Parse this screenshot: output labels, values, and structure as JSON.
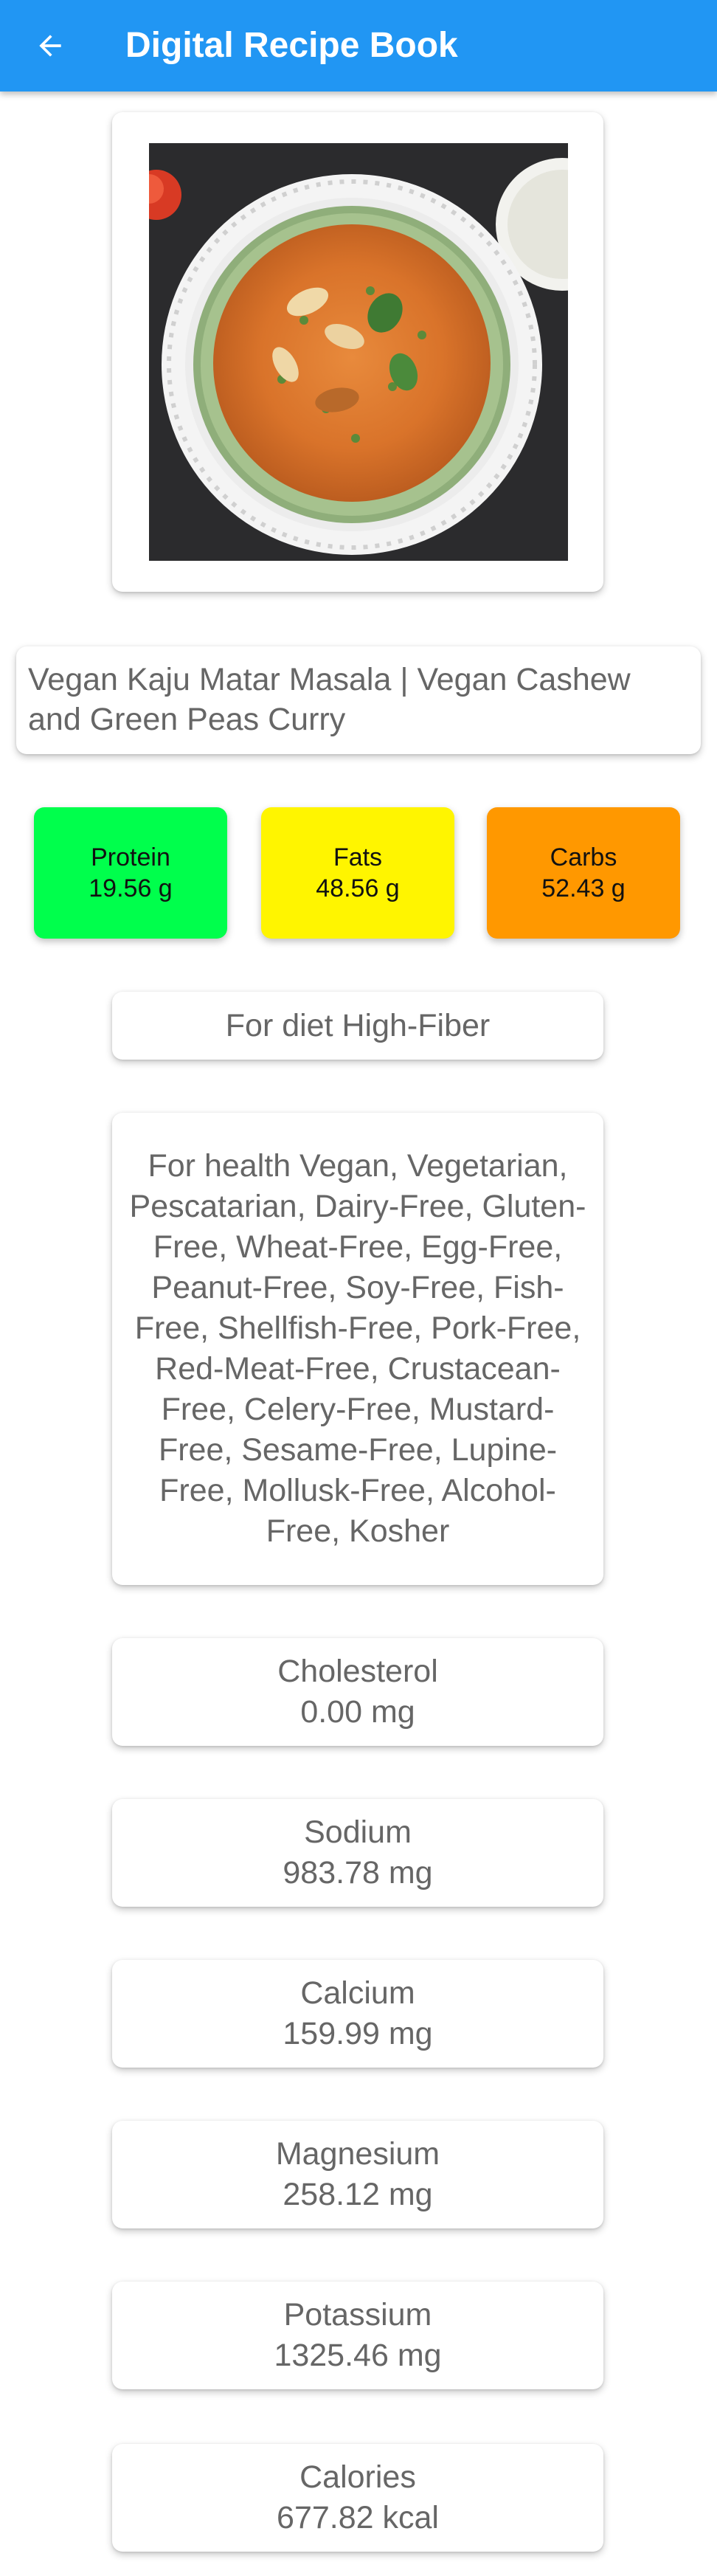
{
  "appbar": {
    "title": "Digital Recipe Book",
    "back_icon": "arrow-left-icon",
    "color": "#2196f3"
  },
  "recipe": {
    "title": "Vegan Kaju Matar Masala | Vegan Cashew and Green Peas Curry",
    "image_alt": "Bowl of orange cashew and green peas curry on a lace doily"
  },
  "macros": {
    "protein": {
      "label": "Protein",
      "value": "19.56 g",
      "color": "#00ff4c"
    },
    "fats": {
      "label": "Fats",
      "value": "48.56 g",
      "color": "#fff500"
    },
    "carbs": {
      "label": "Carbs",
      "value": "52.43 g",
      "color": "#ff9800"
    }
  },
  "diet": {
    "text": "For diet High-Fiber"
  },
  "health": {
    "text": "For health Vegan, Vegetarian, Pescatarian, Dairy-Free, Gluten-Free, Wheat-Free, Egg-Free, Peanut-Free, Soy-Free, Fish-Free, Shellfish-Free, Pork-Free, Red-Meat-Free, Crustacean-Free, Celery-Free, Mustard-Free, Sesame-Free, Lupine-Free, Mollusk-Free, Alcohol-Free, Kosher"
  },
  "nutrients": {
    "cholesterol": {
      "label": "Cholesterol",
      "value": "0.00 mg"
    },
    "sodium": {
      "label": "Sodium",
      "value": "983.78 mg"
    },
    "calcium": {
      "label": "Calcium",
      "value": "159.99 mg"
    },
    "magnesium": {
      "label": "Magnesium",
      "value": "258.12 mg"
    },
    "potassium": {
      "label": "Potassium",
      "value": "1325.46 mg"
    },
    "calories": {
      "label": "Calories",
      "value": "677.82 kcal"
    }
  }
}
